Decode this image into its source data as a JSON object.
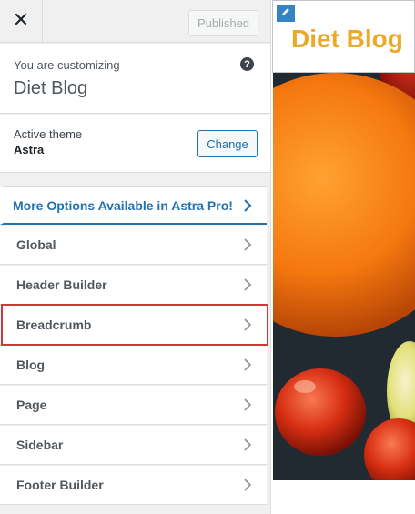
{
  "topbar": {
    "close_icon": "close-icon",
    "publish_label": "Published"
  },
  "info": {
    "subtitle": "You are customizing",
    "site_name": "Diet Blog",
    "help_icon": "help-icon"
  },
  "theme": {
    "label": "Active theme",
    "name": "Astra",
    "change_label": "Change"
  },
  "pro_promo": {
    "label": "More Options Available in Astra Pro!",
    "color": "#2271b1"
  },
  "sections": [
    {
      "label": "Global"
    },
    {
      "label": "Header Builder"
    },
    {
      "label": "Breadcrumb"
    },
    {
      "label": "Blog"
    },
    {
      "label": "Page"
    },
    {
      "label": "Sidebar"
    },
    {
      "label": "Footer Builder"
    }
  ],
  "highlight_color": "#d63638",
  "preview": {
    "site_title": "Diet Blog",
    "title_color": "#eba929",
    "edit_icon": "pencil-icon"
  }
}
